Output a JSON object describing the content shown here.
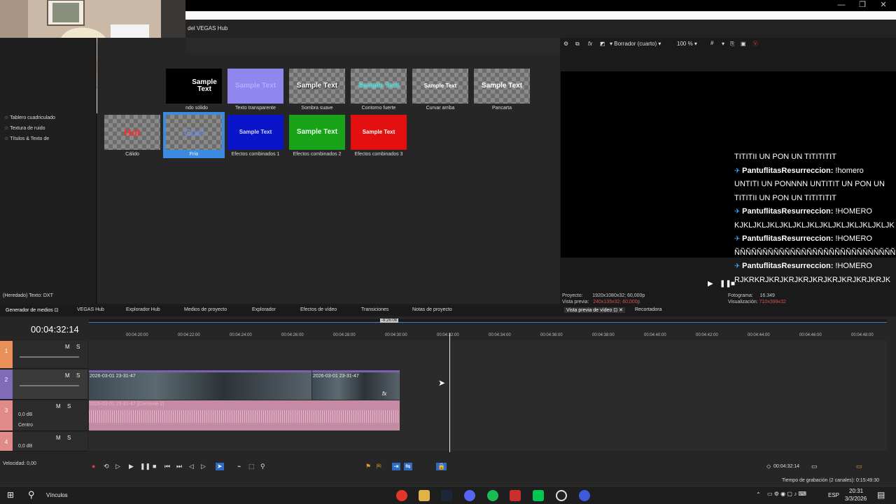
{
  "window": {
    "hub_title": "del VEGAS Hub",
    "minimize": "—",
    "maximize": "❐",
    "close": "✕"
  },
  "tree": {
    "items": [
      "Tablero cuadriculado",
      "Textura de ruido",
      "Títulos & Texto de"
    ],
    "inherited_label": "(Heredado) Texto: DXT"
  },
  "presets": {
    "row1": [
      {
        "label": "ndo sólido",
        "sample": "Sample Text"
      },
      {
        "label": "Texto transparente",
        "sample": "Sample Text"
      },
      {
        "label": "Sombra suave",
        "sample": "Sample Text"
      },
      {
        "label": "Contorno fuerte",
        "sample": "Sample Text"
      },
      {
        "label": "Curvar arriba",
        "sample": "Sample Text"
      },
      {
        "label": "Pancarta",
        "sample": "Sample Text"
      }
    ],
    "row2": [
      {
        "label": "Cálido",
        "sample": "Hot"
      },
      {
        "label": "Frío",
        "sample": "Cool"
      },
      {
        "label": "Efectos combinados 1",
        "sample": "Sample Text"
      },
      {
        "label": "Efectos combinados 2",
        "sample": "Sample Text"
      },
      {
        "label": "Efectos combinados 3",
        "sample": "Sample Text"
      }
    ]
  },
  "preview": {
    "quality": "Borrador (cuarto)",
    "zoom": "100 %",
    "project_label": "Proyecto:",
    "project_value": "1920x1080x32; 60,000p",
    "preview_label": "Vista previa:",
    "preview_value": "240x135x32; 60,000p",
    "frame_label": "Fotograma:",
    "frame_value": "16.349",
    "display_label": "Visualización:",
    "display_value": "710x399x32"
  },
  "chat": [
    {
      "user": "",
      "text": "TITITII UN PON UN TITITITIT"
    },
    {
      "user": "PantuflitasResurreccion:",
      "text": " !homero"
    },
    {
      "user": "",
      "text": "UNTITI UN PONNNN UNTITIT UN PON UN"
    },
    {
      "user": "",
      "text": "TITITII UN PON UN TITITITIT"
    },
    {
      "user": "PantuflitasResurreccion:",
      "text": " !HOMERO"
    },
    {
      "user": "",
      "text": "KJKLJKLJKLJKLJKLJKLJKLJKLJKLJKLJKLJK"
    },
    {
      "user": "PantuflitasResurreccion:",
      "text": " !HOMERO"
    },
    {
      "user": "",
      "text": "ÑÑÑÑÑÑÑÑÑÑÑÑÑÑÑÑÑÑÑÑÑÑÑÑÑÑÑÑÑ"
    },
    {
      "user": "PantuflitasResurreccion:",
      "text": " !HOMERO"
    },
    {
      "user": "",
      "text": "RJKRKRJKRJKRJKRJKRJKRJKRJKRJKRJK"
    }
  ],
  "tabs": [
    "Generador de medios",
    "VEGAS Hub",
    "Explorador Hub",
    "Medios de proyecto",
    "Explorador",
    "Efectos de vídeo",
    "Transiciones",
    "Notas de proyecto",
    "Vista previa de vídeo",
    "Recortadora"
  ],
  "timeline": {
    "time": "00:04:32:14",
    "loop_badge": "-8:26:08",
    "ruler": [
      "00:04:20:00",
      "00:04:22:00",
      "00:04:24:00",
      "00:04:26:00",
      "00:04:28:00",
      "00:04:30:00",
      "00:04:32:00",
      "00:04:34:00",
      "00:04:36:00",
      "00:04:38:00",
      "00:04:40:00",
      "00:04:42:00",
      "00:04:44:00",
      "00:04:46:00",
      "00:04:48:00"
    ],
    "tracks": {
      "t1": {
        "num": "1",
        "m": "M",
        "s": "S"
      },
      "t2": {
        "num": "2",
        "m": "M",
        "s": "S"
      },
      "t3": {
        "num": "3",
        "m": "M",
        "s": "S",
        "vol": "0,0 dB",
        "pan": "Centro"
      },
      "t4": {
        "num": "4",
        "m": "M",
        "s": "S",
        "vol": "0,0 dB"
      }
    },
    "clip_a": "2026-03-01 23-31-47",
    "clip_b": "2026-03-01 23-31-47",
    "audio_clip": "2026-03-01 23-31-47 [Corriente 1]",
    "speed": "Velocidad: 0,00",
    "end_time": "00:04:32:14",
    "record_time": "Tiempo de grabación (2 canales): 0:15:49:30"
  },
  "taskbar": {
    "search": "Vínculos",
    "lang": "ESP",
    "time": "20:31",
    "date": "3/3/2026"
  }
}
